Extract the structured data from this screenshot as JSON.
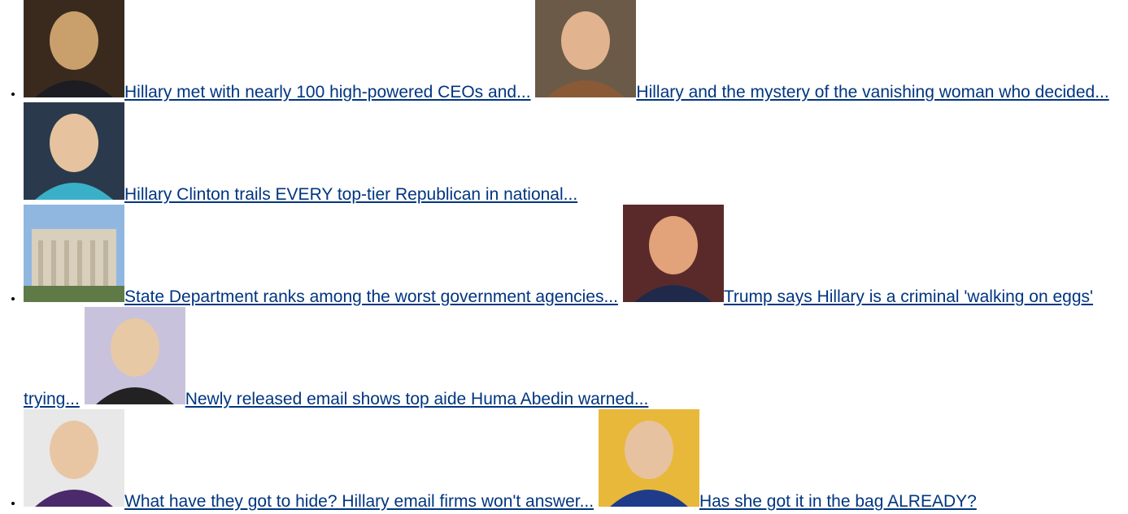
{
  "stories": [
    {
      "title": "Hillary met with nearly 100 high-powered CEOs and...",
      "thumb": "clinton-embrace-photo",
      "colors": {
        "bg": "#3a2a1e",
        "accent": "#c9a06c",
        "suit": "#1c1c22"
      }
    },
    {
      "title": "Hillary and the mystery of the vanishing woman who decided...",
      "thumb": "smiling-woman-photo",
      "colors": {
        "bg": "#6b5a48",
        "accent": "#e2b38f",
        "suit": "#8a5a36"
      }
    },
    {
      "title": "Hillary Clinton trails EVERY top-tier Republican in national...",
      "thumb": "hillary-speaking-photo",
      "colors": {
        "bg": "#2a3a4c",
        "accent": "#e6c39e",
        "suit": "#3ab0c8"
      }
    },
    {
      "title": "State Department ranks among the worst government agencies...",
      "thumb": "state-department-building-photo",
      "colors": {
        "bg": "#8fb7e0",
        "accent": "#d8cfbd",
        "suit": "#5f7a46"
      }
    },
    {
      "title": "Trump says Hillary is a criminal 'walking on eggs' trying...",
      "thumb": "trump-speaking-photo",
      "colors": {
        "bg": "#5a2a2a",
        "accent": "#e2a27a",
        "suit": "#1f2a4a"
      }
    },
    {
      "title": "Newly released email shows top aide Huma Abedin warned...",
      "thumb": "hillary-podium-photo",
      "colors": {
        "bg": "#c9c2dc",
        "accent": "#e7c9a6",
        "suit": "#222222"
      }
    },
    {
      "title": "What have they got to hide? Hillary email firms won't answer...",
      "thumb": "hillary-purple-jacket-photo",
      "colors": {
        "bg": "#e8e8e8",
        "accent": "#e9c6a3",
        "suit": "#4a2a6a"
      }
    },
    {
      "title": "Has she got it in the bag ALREADY?",
      "thumb": "hillary-yellow-background-photo",
      "colors": {
        "bg": "#e8b83a",
        "accent": "#e7c2a0",
        "suit": "#1e3c8a"
      }
    }
  ]
}
